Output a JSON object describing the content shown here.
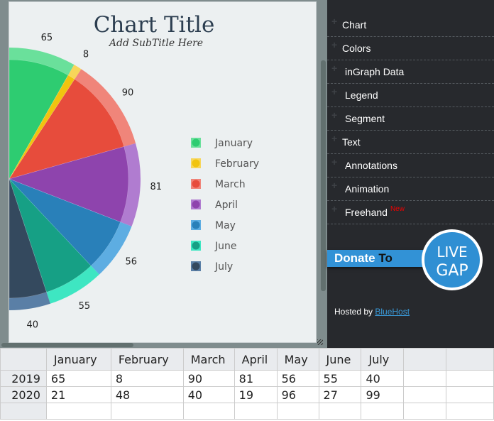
{
  "chart": {
    "title": "Chart Title",
    "subtitle": "Add SubTitle Here"
  },
  "chart_data": {
    "type": "pie",
    "variant": "half-pie (semicircle, left half scrolled out of view)",
    "title": "Chart Title",
    "subtitle": "Add SubTitle Here",
    "categories": [
      "January",
      "February",
      "March",
      "April",
      "May",
      "June",
      "July"
    ],
    "values": [
      65,
      8,
      90,
      81,
      56,
      55,
      40
    ],
    "series_name": "2019",
    "colors": [
      "#2ecc71",
      "#f1c40f",
      "#e74c3c",
      "#8e44ad",
      "#2980b9",
      "#16a085",
      "#34495e"
    ],
    "ring_colors": [
      "#6ae09b",
      "#f7d65a",
      "#f0857a",
      "#b07cd0",
      "#5dade2",
      "#3ee6c2",
      "#5a7fa6"
    ],
    "legend": {
      "position": "right",
      "entries": [
        "January",
        "February",
        "March",
        "April",
        "May",
        "June",
        "July"
      ]
    },
    "data_labels": [
      "65",
      "8",
      "90",
      "81",
      "56",
      "55",
      "40"
    ]
  },
  "sidebar": {
    "items": [
      {
        "label": "Chart",
        "indent": false
      },
      {
        "label": "Colors",
        "indent": false
      },
      {
        "label": "inGraph Data",
        "indent": true
      },
      {
        "label": "Legend",
        "indent": true
      },
      {
        "label": "Segment",
        "indent": true
      },
      {
        "label": "Text",
        "indent": false
      },
      {
        "label": "Annotations",
        "indent": true
      },
      {
        "label": "Animation",
        "indent": true
      },
      {
        "label": "Freehand",
        "indent": true,
        "badge": "New"
      }
    ],
    "donate_label": "Donate",
    "donate_to": "To",
    "logo_text_top": "LIVE",
    "logo_text_bottom": "GAP",
    "hosted_by": "Hosted by ",
    "host_link": "BlueHost"
  },
  "grid": {
    "headers": [
      "",
      "January",
      "February",
      "March",
      "April",
      "May",
      "June",
      "July",
      "",
      ""
    ],
    "rows": [
      [
        "2019",
        "65",
        "8",
        "90",
        "81",
        "56",
        "55",
        "40",
        "",
        ""
      ],
      [
        "2020",
        "21",
        "48",
        "40",
        "19",
        "96",
        "27",
        "99",
        "",
        ""
      ],
      [
        "",
        "",
        "",
        "",
        "",
        "",
        "",
        "",
        "",
        ""
      ]
    ]
  }
}
